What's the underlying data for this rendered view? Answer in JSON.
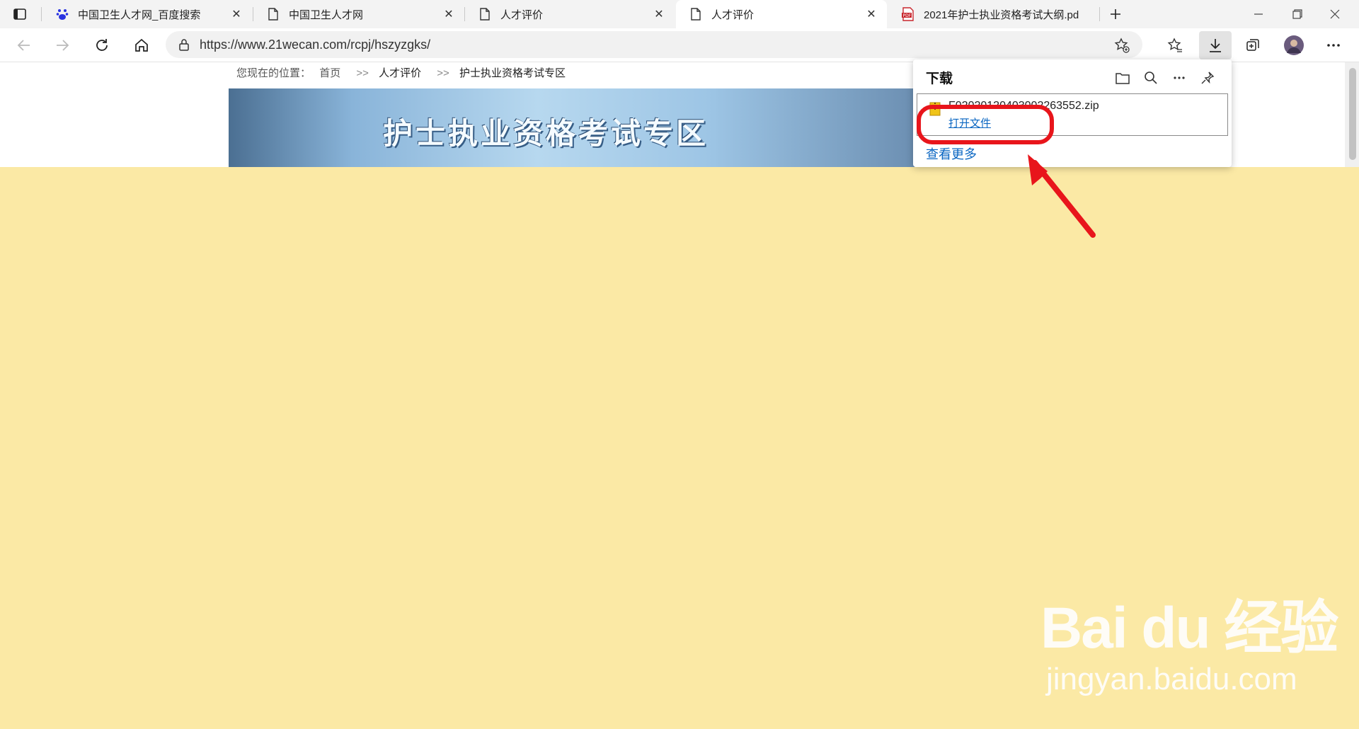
{
  "tabs": [
    {
      "title": "中国卫生人才网_百度搜索",
      "icon": "baidu-paw-icon",
      "active": false
    },
    {
      "title": "中国卫生人才网",
      "icon": "page-icon",
      "active": false
    },
    {
      "title": "人才评价",
      "icon": "page-icon",
      "active": false
    },
    {
      "title": "人才评价",
      "icon": "page-icon",
      "active": true
    },
    {
      "title": "2021年护士执业资格考试大纲.pd",
      "icon": "pdf-icon",
      "active": false
    }
  ],
  "address_bar": {
    "url": "https://www.21wecan.com/rcpj/hszyzgks/"
  },
  "page": {
    "breadcrumb": {
      "prefix": "您现在的位置：",
      "home": "首页",
      "sep": ">>",
      "level1": "人才评价",
      "level2": "护士执业资格考试专区"
    },
    "banner_title": "护士执业资格考试专区"
  },
  "downloads": {
    "title": "下载",
    "file_name": "F02020120403002263552.zip",
    "open_file": "打开文件",
    "see_more": "查看更多"
  },
  "colors": {
    "annotation": "#e8151b",
    "link": "#0a66c2",
    "background": "#fbe9a5"
  },
  "watermark": {
    "brand": "Bai du 经验",
    "url": "jingyan.baidu.com"
  }
}
